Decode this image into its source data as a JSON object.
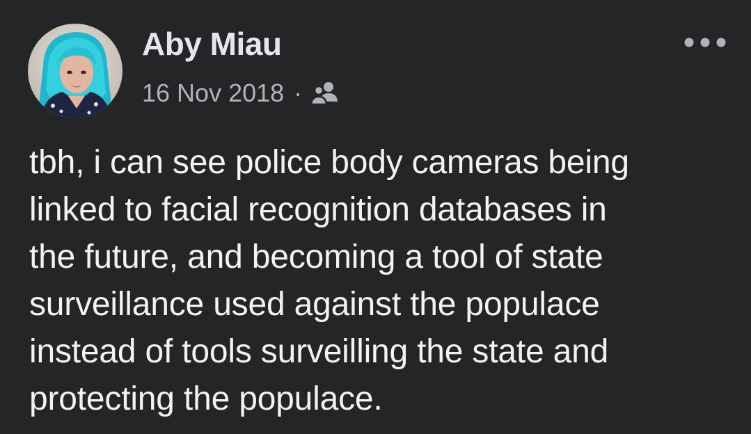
{
  "post": {
    "author": "Aby Miau",
    "date": "16 Nov 2018",
    "separator": "·",
    "audience_icon": "friends-icon",
    "more_icon": "more-options-icon",
    "text": "tbh, i can see police body cameras being\nlinked to facial recognition databases in\nthe future, and becoming a tool of state\nsurveillance used against the populace\ninstead of tools surveilling the state and\nprotecting the populace."
  },
  "colors": {
    "background": "#242526",
    "primary_text": "#e4e6eb",
    "secondary_text": "#b0b3b8",
    "avatar_hair": "#2ec4d6"
  }
}
